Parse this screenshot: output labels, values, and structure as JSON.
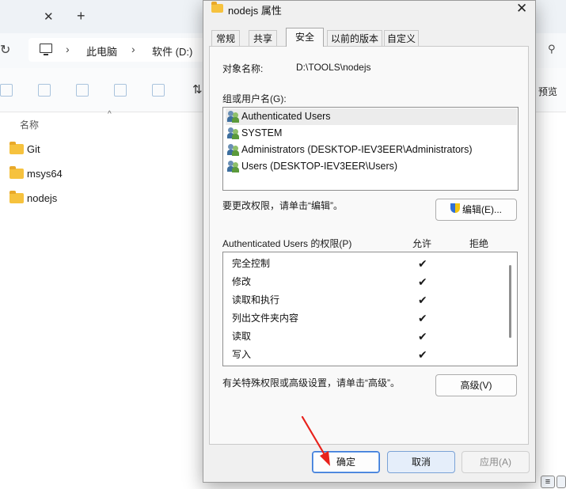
{
  "explorer": {
    "tab_close": "✕",
    "tab_new": "+",
    "breadcrumb": [
      "此电脑",
      "软件 (D:)"
    ],
    "preview_label": "预览",
    "column_header": "名称",
    "files": [
      {
        "name": "Git"
      },
      {
        "name": "msys64"
      },
      {
        "name": "nodejs"
      }
    ]
  },
  "dialog": {
    "title": "nodejs 属性",
    "close": "✕",
    "tabs": [
      {
        "label": "常规"
      },
      {
        "label": "共享"
      },
      {
        "label": "安全",
        "active": true
      },
      {
        "label": "以前的版本"
      },
      {
        "label": "自定义"
      }
    ],
    "object_label": "对象名称:",
    "object_value": "D:\\TOOLS\\nodejs",
    "groups_label": "组或用户名(G):",
    "users": [
      {
        "name": "Authenticated Users",
        "selected": true
      },
      {
        "name": "SYSTEM"
      },
      {
        "name": "Administrators (DESKTOP-IEV3EER\\Administrators)"
      },
      {
        "name": "Users (DESKTOP-IEV3EER\\Users)"
      }
    ],
    "edit_hint": "要更改权限，请单击“编辑”。",
    "edit_button": "编辑(E)...",
    "perm_header": "Authenticated Users 的权限(P)",
    "allow_header": "允许",
    "deny_header": "拒绝",
    "permissions": [
      {
        "name": "完全控制",
        "allow": "✔",
        "deny": ""
      },
      {
        "name": "修改",
        "allow": "✔",
        "deny": ""
      },
      {
        "name": "读取和执行",
        "allow": "✔",
        "deny": ""
      },
      {
        "name": "列出文件夹内容",
        "allow": "✔",
        "deny": ""
      },
      {
        "name": "读取",
        "allow": "✔",
        "deny": ""
      },
      {
        "name": "写入",
        "allow": "✔",
        "deny": ""
      }
    ],
    "advanced_hint": "有关特殊权限或高级设置，请单击“高级”。",
    "advanced_button": "高级(V)",
    "ok_button": "确定",
    "cancel_button": "取消",
    "apply_button": "应用(A)"
  },
  "colors": {
    "arrow": "#e8221c",
    "accent": "#3b78d8",
    "folder": "#f6c23e"
  }
}
